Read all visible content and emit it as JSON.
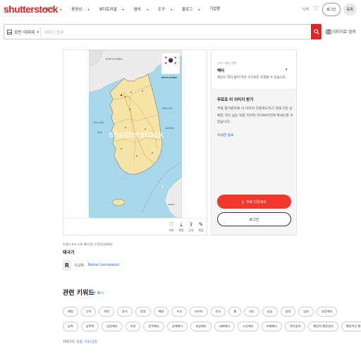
{
  "header": {
    "logo": "shutterstock",
    "nav": [
      {
        "label": "이미지",
        "active": true
      },
      {
        "label": "동영상",
        "active": false
      },
      {
        "label": "에디토리얼",
        "active": false
      },
      {
        "label": "음악",
        "active": false
      },
      {
        "label": "도구",
        "active": false
      },
      {
        "label": "블로그",
        "active": false
      },
      {
        "label": "기업용",
        "active": false
      }
    ],
    "price_link": "가격",
    "login": "로그인",
    "join": "등록"
  },
  "search": {
    "type_label": "모든 이미지",
    "placeholder": "이미지 검색",
    "image_search": "이미지로 검색"
  },
  "map": {
    "labels": {
      "north_korea": "NORTH KOREA",
      "south_korea": "SOUTH KOREA",
      "yellow_sea": "YELLOW",
      "sea": "SEA",
      "sea_of": "SEA OF",
      "japan": "JAPAN",
      "japan_land": "JAPAN",
      "watermark": "shutterstock"
    }
  },
  "image_actions": [
    {
      "label": "저장",
      "icon": "heart-icon"
    },
    {
      "label": "확장",
      "icon": "download-icon"
    },
    {
      "label": "공유",
      "icon": "share-icon"
    },
    {
      "label": "편집",
      "icon": "edit-icon"
    }
  ],
  "side": {
    "size_label": "크기 / 형식 선택",
    "size_value": "벡터",
    "size_note": "해상도 저하 없이 어떤 크기로든 조절할 수 있습니다.",
    "free_title": "무료로 이 이미지 받기",
    "free_desc": "무료 평가판으로 이 이미지 다운로드하기 최대 1천 상백만 개가 넘는 모든 이미지 라이브러리에 액세스할 수 있습니다.",
    "free_link": "자세한 정보",
    "download_btn": "무료 다운로드",
    "login_btn": "로그인"
  },
  "meta": {
    "prefix": "로열티 프리 스톡",
    "type": "벡터",
    "id_text": "ID: 2761532963",
    "title": "태극기",
    "contributor_prefix": "기고자:",
    "contributor_name": "Rainer Lesniewski",
    "avatar_letter": "R"
  },
  "keywords": {
    "title": "관련 키워드",
    "see_all": "모두 표시",
    "row1": [
      "제됨",
      "근직",
      "대한",
      "동국",
      "동원",
      "배달",
      "조선",
      "코리아",
      "한국",
      "웹",
      "지도",
      "남남",
      "남방",
      "남부",
      "남동해다"
    ],
    "row2": [
      "남쪽",
      "남쪽쪽",
      "남방해다",
      "모양",
      "동쪽해다",
      "상해해다",
      "세일해다",
      "세레해다",
      "소상해다",
      "지혜해다",
      "관리실의",
      "행정적 행정실의",
      "행정적인 행정실의"
    ]
  },
  "category": {
    "prefix": "카테고리:",
    "values": "운송, 기호/상징"
  }
}
